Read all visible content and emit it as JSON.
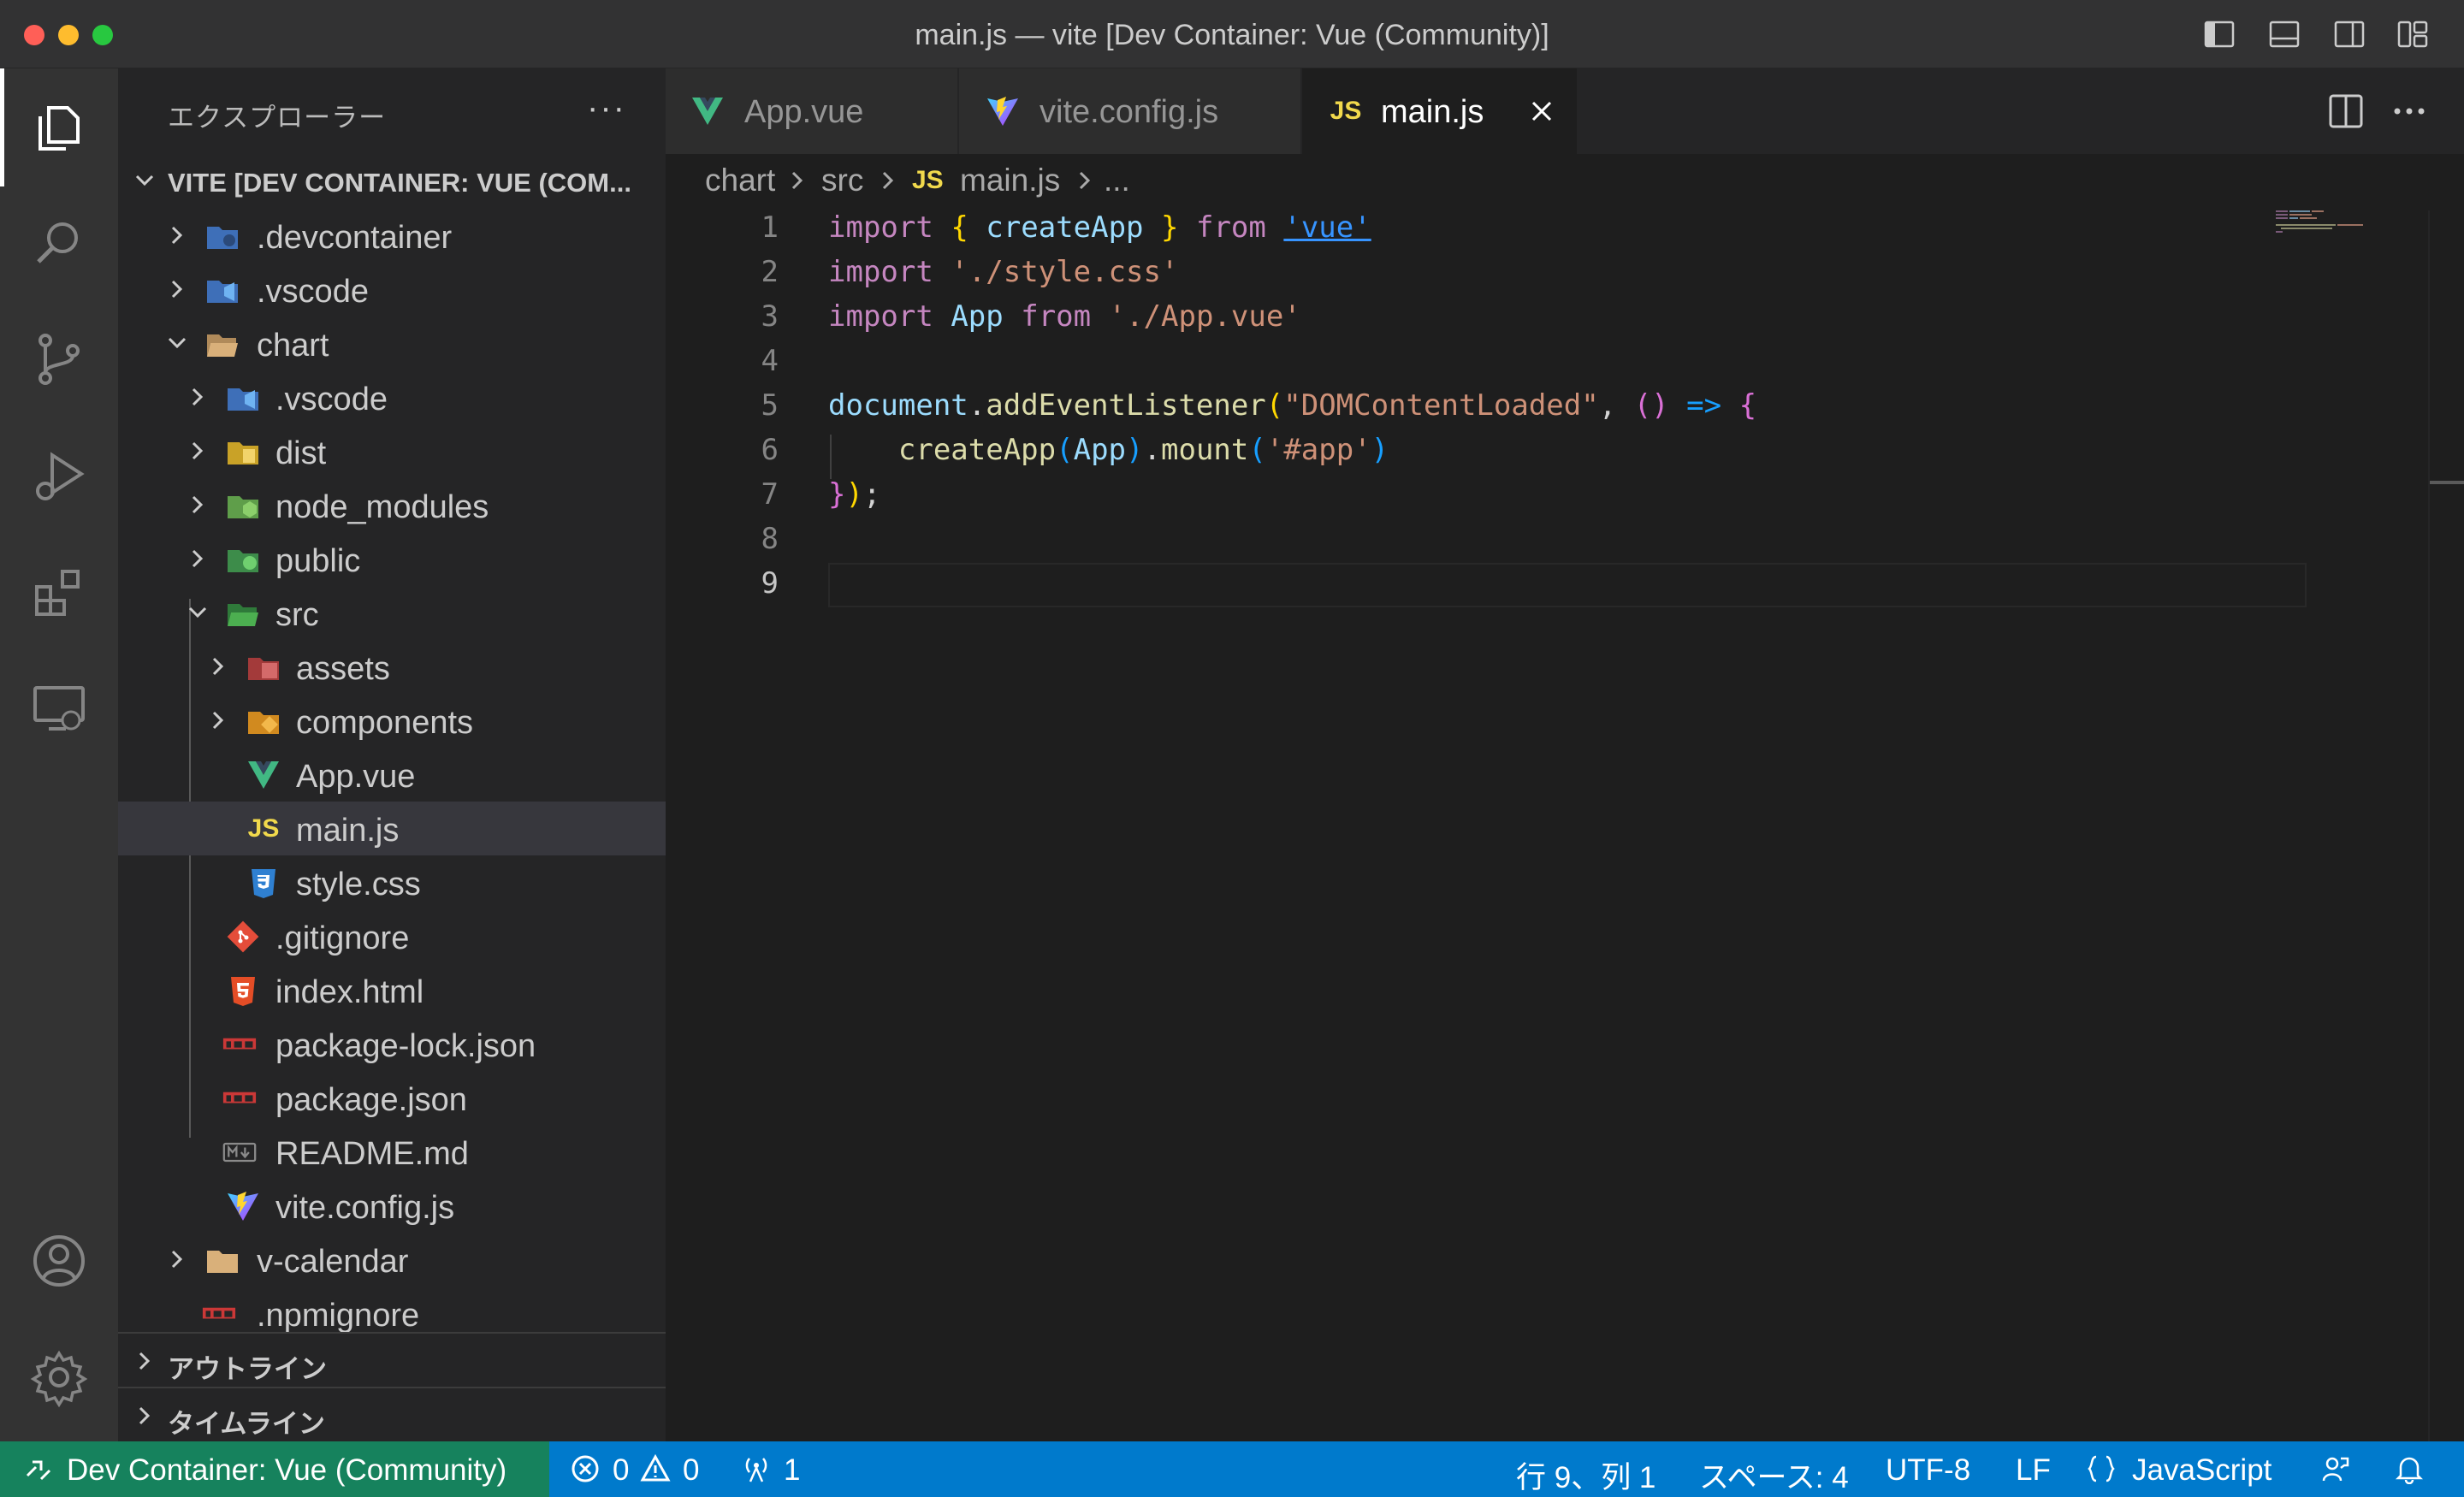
{
  "window": {
    "title": "main.js — vite [Dev Container: Vue (Community)]"
  },
  "sidebar": {
    "title": "エクスプローラー",
    "more_label": "···",
    "root_label": "VITE [DEV CONTAINER: VUE (COM...",
    "items": [
      {
        "label": ".devcontainer",
        "icon": "folder-devcontainer-icon"
      },
      {
        "label": ".vscode",
        "icon": "folder-vscode-icon"
      },
      {
        "label": "chart",
        "icon": "folder-open-icon"
      },
      {
        "label": ".vscode",
        "icon": "folder-vscode-icon"
      },
      {
        "label": "dist",
        "icon": "folder-dist-icon"
      },
      {
        "label": "node_modules",
        "icon": "folder-node-icon"
      },
      {
        "label": "public",
        "icon": "folder-public-icon"
      },
      {
        "label": "src",
        "icon": "folder-src-icon"
      },
      {
        "label": "assets",
        "icon": "folder-assets-icon"
      },
      {
        "label": "components",
        "icon": "folder-components-icon"
      },
      {
        "label": "App.vue",
        "icon": "vue-file-icon"
      },
      {
        "label": "main.js",
        "icon": "js-file-icon"
      },
      {
        "label": "style.css",
        "icon": "css-file-icon"
      },
      {
        "label": ".gitignore",
        "icon": "git-file-icon"
      },
      {
        "label": "index.html",
        "icon": "html-file-icon"
      },
      {
        "label": "package-lock.json",
        "icon": "npm-file-icon"
      },
      {
        "label": "package.json",
        "icon": "npm-file-icon"
      },
      {
        "label": "README.md",
        "icon": "markdown-file-icon"
      },
      {
        "label": "vite.config.js",
        "icon": "vite-file-icon"
      },
      {
        "label": "v-calendar",
        "icon": "folder-icon"
      },
      {
        "label": ".npmignore",
        "icon": "npm-file-icon"
      }
    ],
    "outline_label": "アウトライン",
    "timeline_label": "タイムライン"
  },
  "tabs": [
    {
      "label": "App.vue",
      "icon": "vue-file-icon",
      "active": false
    },
    {
      "label": "vite.config.js",
      "icon": "vite-file-icon",
      "active": false
    },
    {
      "label": "main.js",
      "icon": "js-file-icon",
      "active": true
    }
  ],
  "breadcrumb": {
    "items": [
      "chart",
      "src",
      "main.js",
      "..."
    ],
    "js_badge": "JS"
  },
  "editor": {
    "line_numbers": [
      "1",
      "2",
      "3",
      "4",
      "5",
      "6",
      "7",
      "8",
      "9"
    ],
    "current_line": 9,
    "code": {
      "l1_import": "import",
      "l1_open": "{",
      "l1_name": "createApp",
      "l1_close": "}",
      "l1_from": "from",
      "l1_mod": "'vue'",
      "l2_import": "import",
      "l2_mod": "'./style.css'",
      "l3_import": "import",
      "l3_name": "App",
      "l3_from": "from",
      "l3_mod": "'./App.vue'",
      "l5_obj": "document",
      "l5_dot": ".",
      "l5_fn": "addEventListener",
      "l5_open": "(",
      "l5_evt": "\"DOMContentLoaded\"",
      "l5_comma": ",",
      "l5_parens": "()",
      "l5_arrow": "=>",
      "l5_brace": "{",
      "l6_fn": "createApp",
      "l6_open": "(",
      "l6_arg": "App",
      "l6_close": ")",
      "l6_dot": ".",
      "l6_mount": "mount",
      "l6_open2": "(",
      "l6_sel": "'#app'",
      "l6_close2": ")",
      "l7_brace": "}",
      "l7_paren": ")",
      "l7_semi": ";"
    }
  },
  "statusbar": {
    "remote": "Dev Container: Vue (Community)",
    "errors": "0",
    "warnings": "0",
    "ports": "1",
    "position": "行 9、列 1",
    "spaces": "スペース: 4",
    "encoding": "UTF-8",
    "eol": "LF",
    "language": "JavaScript"
  },
  "colors": {
    "statusbar": "#007acc",
    "remote": "#16825d",
    "keyword": "#c586c0",
    "string": "#ce9178",
    "function": "#dcdcaa",
    "variable": "#9cdcfe"
  }
}
